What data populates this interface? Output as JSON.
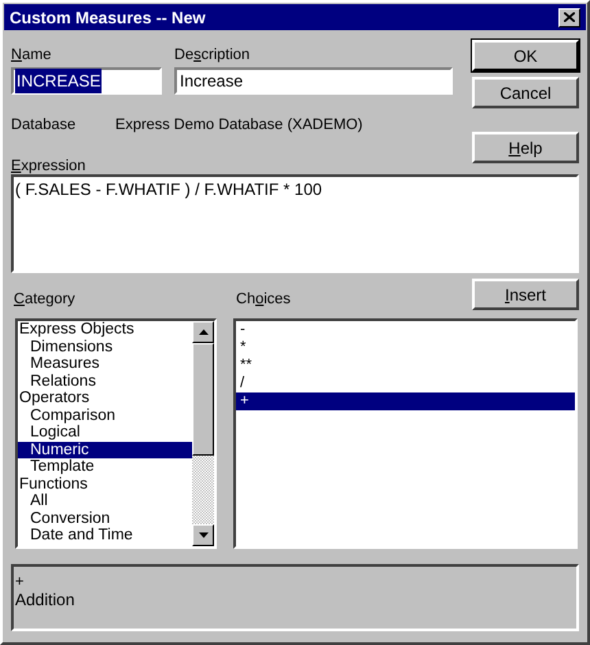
{
  "window": {
    "title": "Custom Measures -- New"
  },
  "name_field": {
    "label": [
      {
        "text": "N",
        "underline": true
      },
      {
        "text": "ame",
        "underline": false
      }
    ],
    "value": "INCREASE"
  },
  "description_field": {
    "label": [
      {
        "text": "De",
        "underline": false
      },
      {
        "text": "s",
        "underline": true
      },
      {
        "text": "cription",
        "underline": false
      }
    ],
    "value": "Increase"
  },
  "database": {
    "label": "Database",
    "value": "Express Demo Database (XADEMO)"
  },
  "expression": {
    "label": [
      {
        "text": "E",
        "underline": true
      },
      {
        "text": "xpression",
        "underline": false
      }
    ],
    "value": "( F.SALES - F.WHATIF ) / F.WHATIF * 100"
  },
  "buttons": [
    {
      "label": [
        {
          "text": "OK",
          "underline": false
        }
      ],
      "default": true
    },
    {
      "label": [
        {
          "text": "Cancel",
          "underline": false
        }
      ],
      "default": false
    },
    {
      "label": [
        {
          "text": "H",
          "underline": true
        },
        {
          "text": "elp",
          "underline": false
        }
      ],
      "default": false
    },
    {
      "label": [
        {
          "text": "I",
          "underline": true
        },
        {
          "text": "nsert",
          "underline": false
        }
      ],
      "default": false
    }
  ],
  "category": {
    "label": [
      {
        "text": "C",
        "underline": true
      },
      {
        "text": "ategory",
        "underline": false
      }
    ],
    "items": [
      {
        "label": "Express Objects",
        "selected": false,
        "children": [
          {
            "label": "Dimensions",
            "selected": false
          },
          {
            "label": "Measures",
            "selected": false
          },
          {
            "label": "Relations",
            "selected": false
          }
        ]
      },
      {
        "label": "Operators",
        "selected": false,
        "children": [
          {
            "label": "Comparison",
            "selected": false
          },
          {
            "label": "Logical",
            "selected": false
          },
          {
            "label": "Numeric",
            "selected": true
          },
          {
            "label": "Template",
            "selected": false
          }
        ]
      },
      {
        "label": "Functions",
        "selected": false,
        "children": [
          {
            "label": "All",
            "selected": false
          },
          {
            "label": "Conversion",
            "selected": false
          },
          {
            "label": "Date and Time",
            "selected": false
          }
        ]
      }
    ]
  },
  "choices": {
    "label": [
      {
        "text": "Ch",
        "underline": false
      },
      {
        "text": "o",
        "underline": true
      },
      {
        "text": "ices",
        "underline": false
      }
    ],
    "items": [
      {
        "label": "-",
        "selected": false
      },
      {
        "label": "*",
        "selected": false
      },
      {
        "label": "**",
        "selected": false
      },
      {
        "label": "/",
        "selected": false
      },
      {
        "label": "+",
        "selected": true
      }
    ]
  },
  "info": {
    "symbol": "+",
    "meaning": "Addition"
  }
}
